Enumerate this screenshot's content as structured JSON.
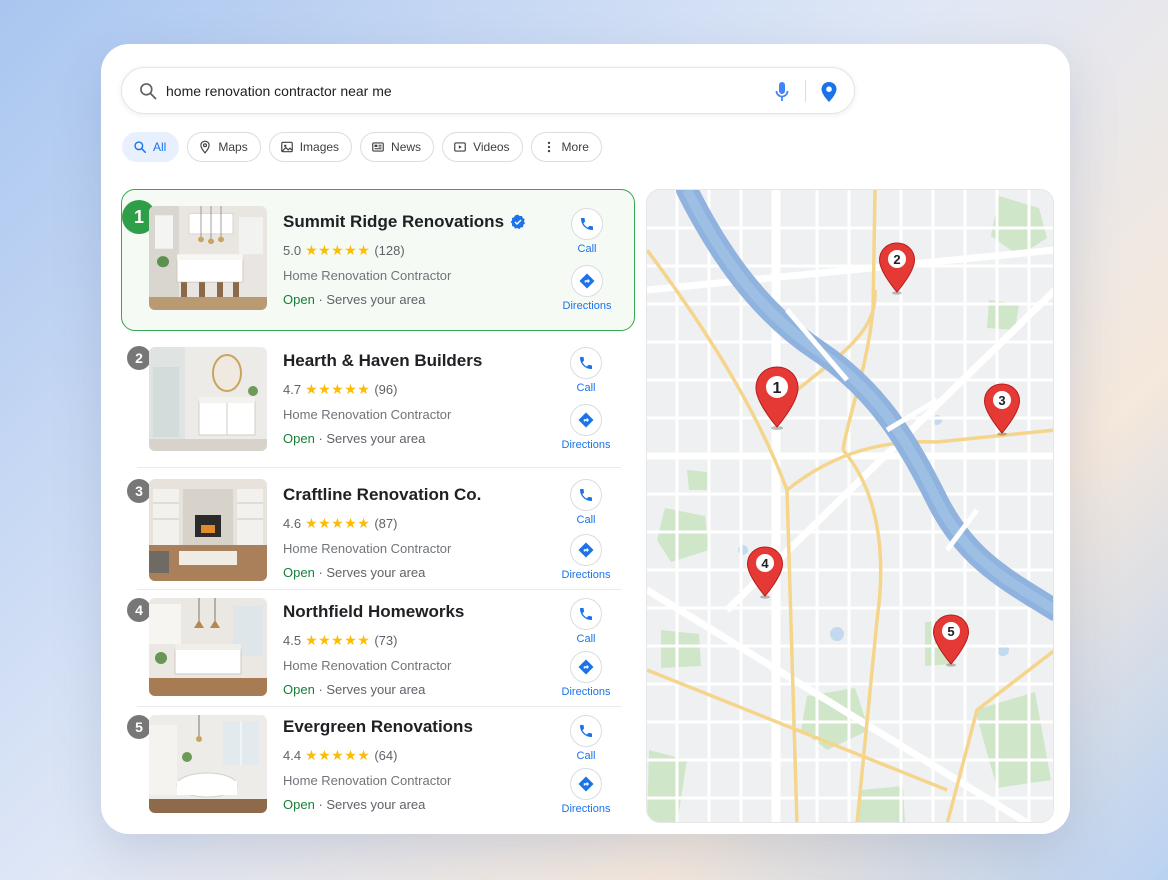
{
  "search": {
    "query": "home renovation contractor near me"
  },
  "chips": [
    {
      "label": "All",
      "icon": "search-icon",
      "active": true
    },
    {
      "label": "Maps",
      "icon": "map-pin-icon"
    },
    {
      "label": "Images",
      "icon": "image-icon"
    },
    {
      "label": "News",
      "icon": "news-icon"
    },
    {
      "label": "Videos",
      "icon": "video-icon"
    },
    {
      "label": "More",
      "icon": "more-vert-icon"
    }
  ],
  "results": [
    {
      "rank": "1",
      "name": "Summit Ridge Renovations",
      "verified": true,
      "rating": "5.0",
      "stars": "★★★★★",
      "reviews": "(128)",
      "category": "Home Renovation Contractor",
      "status": "Open",
      "service": "Serves your area",
      "call_label": "Call",
      "directions_label": "Directions"
    },
    {
      "rank": "2",
      "name": "Hearth & Haven Builders",
      "rating": "4.7",
      "stars": "★★★★★",
      "reviews": "(96)",
      "category": "Home Renovation Contractor",
      "status": "Open",
      "service": "Serves your area",
      "call_label": "Call",
      "directions_label": "Directions"
    },
    {
      "rank": "3",
      "name": "Craftline Renovation Co.",
      "rating": "4.6",
      "stars": "★★★★★",
      "reviews": "(87)",
      "category": "Home Renovation Contractor",
      "status": "Open",
      "service": "Serves your area",
      "call_label": "Call",
      "directions_label": "Directions"
    },
    {
      "rank": "4",
      "name": "Northfield Homeworks",
      "rating": "4.5",
      "stars": "★★★★★",
      "reviews": "(73)",
      "category": "Home Renovation Contractor",
      "status": "Open",
      "service": "Serves your area",
      "call_label": "Call",
      "directions_label": "Directions"
    },
    {
      "rank": "5",
      "name": "Evergreen Renovations",
      "rating": "4.4",
      "stars": "★★★★★",
      "reviews": "(64)",
      "category": "Home Renovation Contractor",
      "status": "Open",
      "service": "Serves your area",
      "call_label": "Call",
      "directions_label": "Directions"
    }
  ],
  "map": {
    "markers": [
      "1",
      "2",
      "3",
      "4",
      "5"
    ]
  },
  "colors": {
    "accent": "#1a73e8",
    "selected_border": "#34a853",
    "open_green": "#188038",
    "star": "#fbbc04",
    "marker_red": "#e53935",
    "river": "#8fb3de",
    "park": "#cfe6c8"
  }
}
